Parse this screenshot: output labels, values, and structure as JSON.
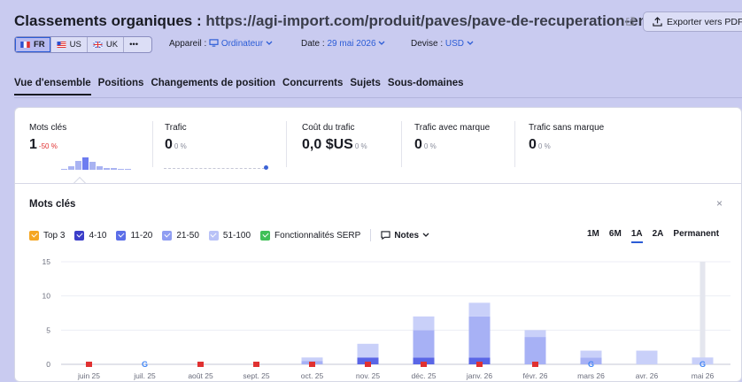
{
  "header": {
    "title_prefix": "Classements organiques : ",
    "title_url": "https://agi-import.com/produit/paves/pave-de-recuperation-en-pi...",
    "export_label": "Exporter vers PDF"
  },
  "databases": [
    {
      "code": "FR",
      "active": true
    },
    {
      "code": "US",
      "active": false
    },
    {
      "code": "UK",
      "active": false
    },
    {
      "code": "•••",
      "active": false
    }
  ],
  "selectors": {
    "device_label": "Appareil :",
    "device_value": "Ordinateur",
    "date_label": "Date :",
    "date_value": "29 mai 2026",
    "currency_label": "Devise :",
    "currency_value": "USD"
  },
  "tabs": [
    "Vue d'ensemble",
    "Positions",
    "Changements de position",
    "Concurrents",
    "Sujets",
    "Sous-domaines"
  ],
  "metrics": [
    {
      "label": "Mots clés",
      "value": "1",
      "change": "-50 %"
    },
    {
      "label": "Trafic",
      "value": "0",
      "change": "0 %"
    },
    {
      "label": "Coût du trafic",
      "value": "0,0 $US",
      "change": "0 %"
    },
    {
      "label": "Trafic avec marque",
      "value": "0",
      "change": "0 %"
    },
    {
      "label": "Trafic sans marque",
      "value": "0",
      "change": "0 %"
    }
  ],
  "keywords_panel": {
    "title": "Mots clés",
    "close": "×",
    "legend": [
      {
        "label": "Top 3",
        "color": "#f5a623"
      },
      {
        "label": "4-10",
        "color": "#3b3ec9"
      },
      {
        "label": "11-20",
        "color": "#5b6ee8"
      },
      {
        "label": "21-50",
        "color": "#8f9df2"
      },
      {
        "label": "51-100",
        "color": "#b9c2f7"
      },
      {
        "label": "Fonctionnalités SERP",
        "color": "#40c057"
      }
    ],
    "notes_label": "Notes",
    "periods": [
      "1M",
      "6M",
      "1A",
      "2A",
      "Permanent"
    ],
    "active_period": "1A"
  },
  "chart_data": {
    "type": "bar",
    "categories": [
      "juin 25",
      "juil. 25",
      "août 25",
      "sept. 25",
      "oct. 25",
      "nov. 25",
      "déc. 25",
      "janv. 26",
      "févr. 26",
      "mars 26",
      "avr. 26",
      "mai 26"
    ],
    "series": [
      {
        "name": "4-10",
        "values": [
          0,
          0,
          0,
          0,
          0,
          1,
          1,
          1,
          0,
          0,
          0,
          0
        ]
      },
      {
        "name": "11-20",
        "values": [
          0,
          0,
          0,
          0,
          0.5,
          0,
          4,
          6,
          4,
          1,
          0,
          0
        ]
      },
      {
        "name": "21-50",
        "values": [
          0,
          0,
          0,
          0,
          0.5,
          2,
          2,
          2,
          1,
          1,
          2,
          1
        ]
      }
    ],
    "ylim": [
      0,
      15
    ],
    "yticks": [
      0,
      5,
      10,
      15
    ],
    "markers": [
      "flag",
      "google",
      "flag",
      "flag",
      "flag",
      "flag",
      "flag",
      "flag",
      "flag",
      "google",
      "",
      "google"
    ],
    "colors": {
      "4-10": "#5a66e6",
      "11-20": "#a7b1f5",
      "21-50": "#c9d0f9"
    }
  }
}
